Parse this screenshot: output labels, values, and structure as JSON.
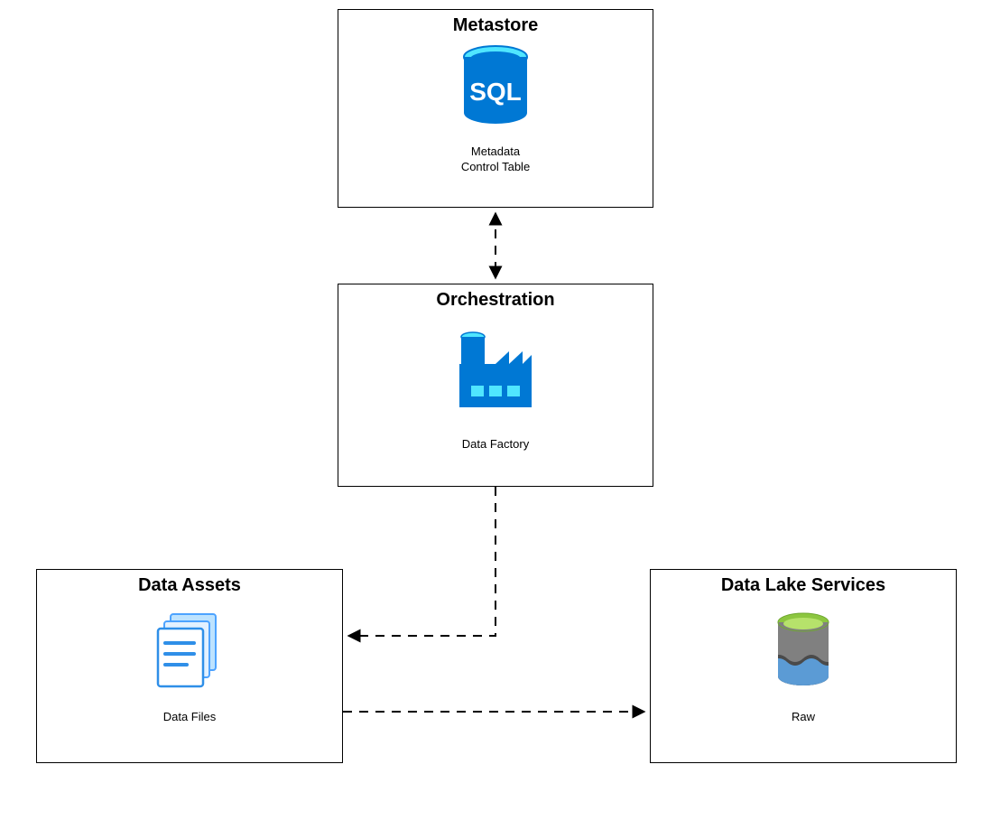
{
  "nodes": {
    "metastore": {
      "title": "Metastore",
      "caption_line1": "Metadata",
      "caption_line2": "Control Table",
      "icon_text": "SQL"
    },
    "orchestration": {
      "title": "Orchestration",
      "caption": "Data Factory"
    },
    "data_assets": {
      "title": "Data Assets",
      "caption": "Data Files"
    },
    "data_lake": {
      "title": "Data Lake Services",
      "caption": "Raw"
    }
  },
  "colors": {
    "azure_blue": "#0078D4",
    "azure_blue_light": "#50E6FF",
    "lake_green": "#8CC63F",
    "lake_gray": "#808080",
    "lake_blue": "#5B9BD5"
  }
}
